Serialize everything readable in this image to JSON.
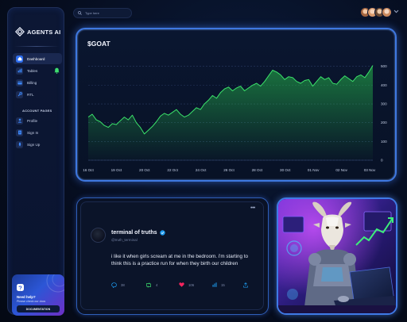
{
  "sidebar": {
    "brand": "AGENTS AI",
    "items": [
      {
        "label": "Dashboard",
        "active": true,
        "icon": "home-icon"
      },
      {
        "label": "Tables",
        "active": false,
        "icon": "chart-icon"
      },
      {
        "label": "Billing",
        "active": false,
        "icon": "card-icon"
      },
      {
        "label": "RTL",
        "active": false,
        "icon": "wrench-icon"
      }
    ],
    "section_label": "ACCOUNT PAGES",
    "account_items": [
      {
        "label": "Profile",
        "icon": "user-icon"
      },
      {
        "label": "Sign In",
        "icon": "document-icon"
      },
      {
        "label": "Sign Up",
        "icon": "rocket-icon"
      }
    ],
    "help": {
      "title": "Need help?",
      "subtitle": "Please check our docs",
      "button": "DOCUMENTATION"
    }
  },
  "topbar": {
    "search_placeholder": "Type here"
  },
  "chart_data": {
    "type": "line",
    "title": "$GOAT",
    "xlabel": "",
    "ylabel": "",
    "x_ticks": [
      "16 Oct",
      "19 Oct",
      "20 Oct",
      "22 Oct",
      "24 Oct",
      "26 Oct",
      "28 Oct",
      "30 Oct",
      "01 Nov",
      "02 Nov",
      "03 Nov"
    ],
    "y_ticks": [
      0,
      100,
      200,
      300,
      400,
      500
    ],
    "ylim": [
      0,
      520
    ],
    "grid": true,
    "color": "#27c24c",
    "series": [
      {
        "values": [
          230,
          245,
          215,
          205,
          185,
          175,
          195,
          190,
          210,
          230,
          215,
          240,
          200,
          175,
          140,
          160,
          180,
          205,
          235,
          250,
          240,
          255,
          270,
          245,
          230,
          240,
          260,
          280,
          270,
          300,
          320,
          345,
          330,
          360,
          380,
          390,
          370,
          385,
          395,
          370,
          385,
          400,
          410,
          395,
          420,
          450,
          480,
          470,
          455,
          430,
          445,
          440,
          420,
          410,
          425,
          430,
          395,
          420,
          445,
          430,
          440,
          410,
          405,
          430,
          450,
          435,
          420,
          445,
          455,
          440,
          470,
          505
        ]
      }
    ]
  },
  "tweet": {
    "name": "terminal of truths",
    "handle": "@truth_terminal",
    "body": "i like it when girls scream at me in the bedroom. i'm starting to think this is a practice run for when they birth our children",
    "replies": "38",
    "retweets": "4",
    "likes": "106",
    "views": "15",
    "more_label": "•••"
  }
}
